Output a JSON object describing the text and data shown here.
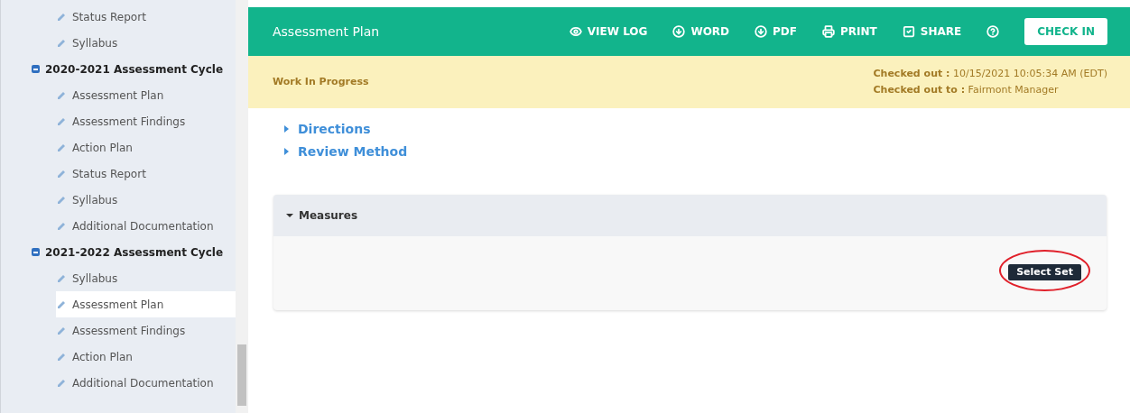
{
  "sidebar": {
    "groups": [
      {
        "items": [
          {
            "label": "Status Report",
            "selected": false
          },
          {
            "label": "Syllabus",
            "selected": false
          }
        ]
      },
      {
        "title": "2020-2021 Assessment Cycle",
        "expanded": true,
        "items": [
          {
            "label": "Assessment Plan",
            "selected": false
          },
          {
            "label": "Assessment Findings",
            "selected": false
          },
          {
            "label": "Action Plan",
            "selected": false
          },
          {
            "label": "Status Report",
            "selected": false
          },
          {
            "label": "Syllabus",
            "selected": false
          },
          {
            "label": "Additional Documentation",
            "selected": false
          }
        ]
      },
      {
        "title": "2021-2022 Assessment Cycle",
        "expanded": true,
        "items": [
          {
            "label": "Syllabus",
            "selected": false
          },
          {
            "label": "Assessment Plan",
            "selected": true
          },
          {
            "label": "Assessment Findings",
            "selected": false
          },
          {
            "label": "Action Plan",
            "selected": false
          },
          {
            "label": "Additional Documentation",
            "selected": false
          }
        ]
      }
    ]
  },
  "header": {
    "title": "Assessment Plan",
    "actions": [
      {
        "kind": "eye",
        "label": "VIEW LOG"
      },
      {
        "kind": "download",
        "label": "WORD"
      },
      {
        "kind": "download",
        "label": "PDF"
      },
      {
        "kind": "print",
        "label": "PRINT"
      },
      {
        "kind": "check",
        "label": "SHARE"
      },
      {
        "kind": "help"
      }
    ],
    "button": "CHECK IN"
  },
  "status_bar": {
    "status": "Work In Progress",
    "lines": [
      {
        "label": "Checked out :",
        "value": "10/15/2021 10:05:34 AM (EDT)"
      },
      {
        "label": "Checked out to :",
        "value": "Fairmont Manager"
      }
    ]
  },
  "sections": [
    {
      "label": "Directions",
      "expanded": false
    },
    {
      "label": "Review Method",
      "expanded": false
    }
  ],
  "panel": {
    "title": "Measures",
    "expanded": true,
    "button": "Select Set",
    "highlighted": true
  }
}
